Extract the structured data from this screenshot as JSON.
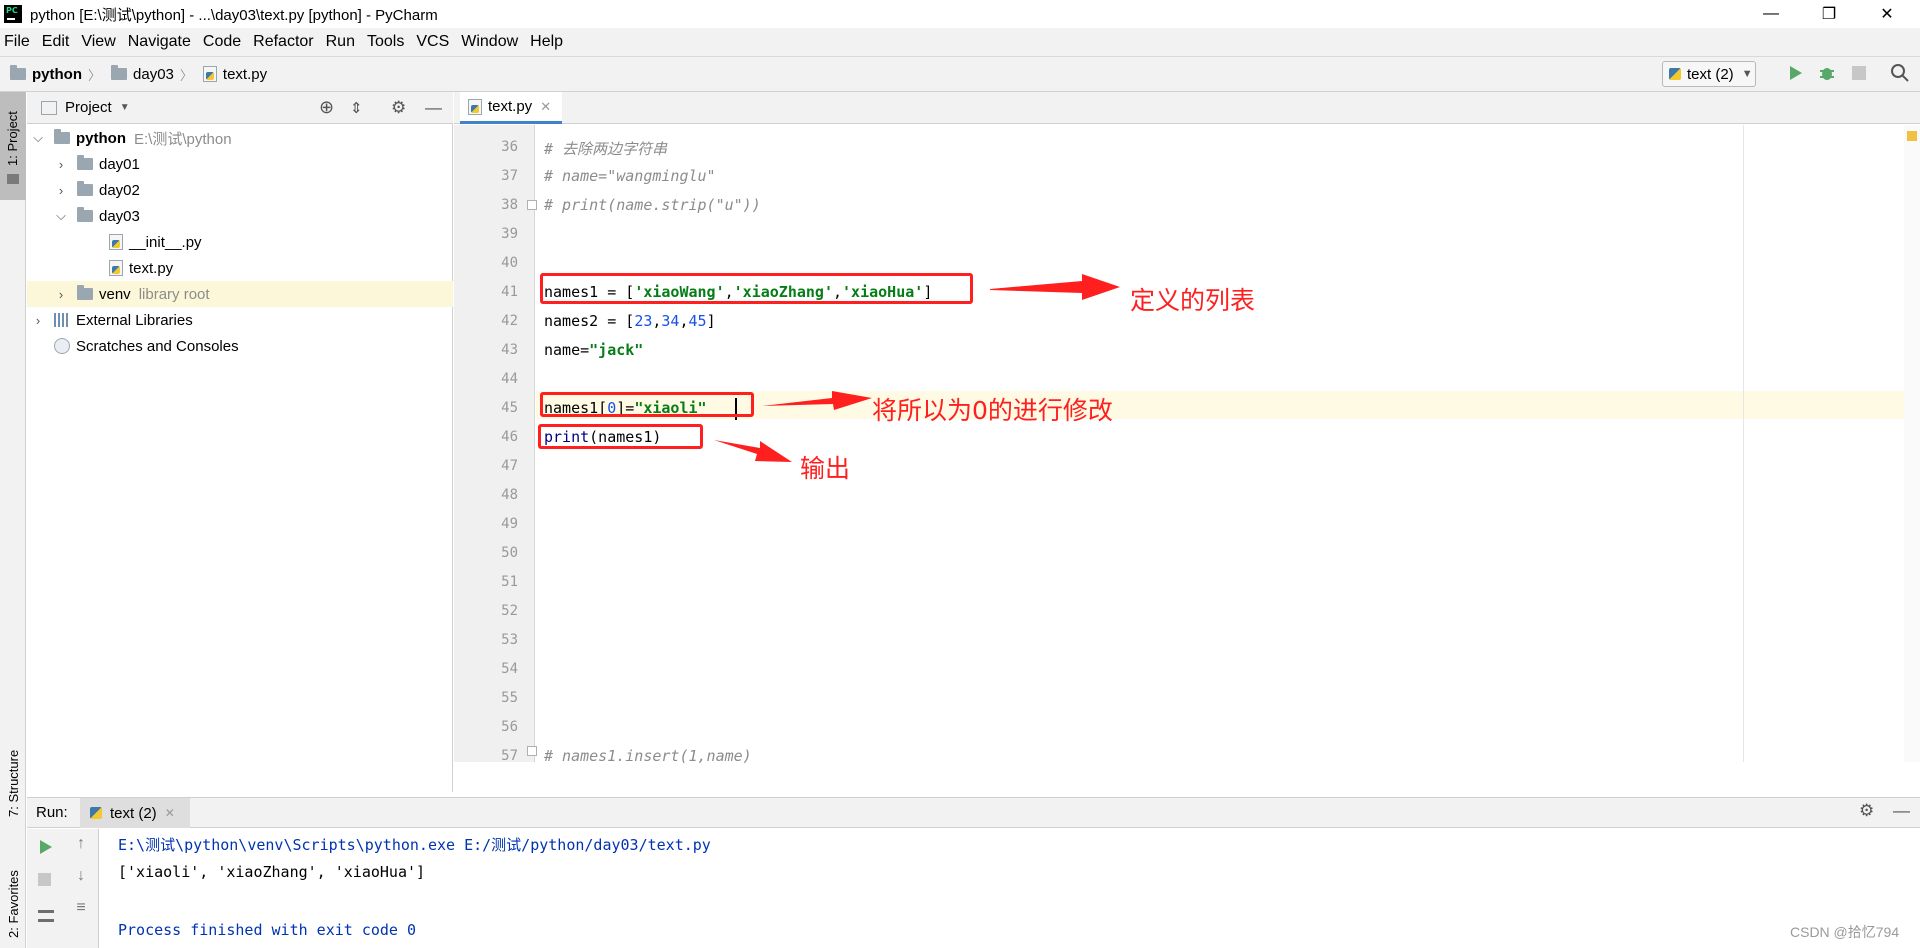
{
  "window": {
    "title": "python [E:\\测试\\python] - ...\\day03\\text.py [python] - PyCharm",
    "minimize": "—",
    "maximize": "❐",
    "close": "✕"
  },
  "menu": [
    "File",
    "Edit",
    "View",
    "Navigate",
    "Code",
    "Refactor",
    "Run",
    "Tools",
    "VCS",
    "Window",
    "Help"
  ],
  "breadcrumb": [
    "python",
    "day03",
    "text.py"
  ],
  "run_config": "text (2)",
  "stripe": {
    "project": "1: Project",
    "structure": "7: Structure",
    "favorites": "2: Favorites"
  },
  "project_panel": {
    "title": "Project",
    "tree": [
      {
        "label": "python",
        "extra": "E:\\测试\\python"
      },
      {
        "label": "day01"
      },
      {
        "label": "day02"
      },
      {
        "label": "day03"
      },
      {
        "label": "__init__.py"
      },
      {
        "label": "text.py"
      },
      {
        "label": "venv",
        "extra": "library root"
      },
      {
        "label": "External Libraries"
      },
      {
        "label": "Scratches and Consoles"
      }
    ]
  },
  "editor": {
    "tab": "text.py",
    "line_numbers": [
      "36",
      "37",
      "38",
      "39",
      "40",
      "41",
      "42",
      "43",
      "44",
      "45",
      "46",
      "47",
      "48",
      "49",
      "50",
      "51",
      "52",
      "53",
      "54",
      "55",
      "56",
      "57"
    ],
    "code": {
      "l36": "# 去除两边字符串",
      "l37": "# name=\"wangminglu\"",
      "l38": "# print(name.strip(\"u\"))",
      "l41_var": "names1 = [",
      "l41_s1": "'xiaoWang'",
      "l41_c1": ",",
      "l41_s2": "'xiaoZhang'",
      "l41_c2": ",",
      "l41_s3": "'xiaoHua'",
      "l41_end": "]",
      "l42_var": "names2 = [",
      "l42_n1": "23",
      "l42_c1": ",",
      "l42_n2": "34",
      "l42_c2": ",",
      "l42_n3": "45",
      "l42_end": "]",
      "l43_var": "name=",
      "l43_str": "\"jack\"",
      "l45_var": "names1[",
      "l45_idx": "0",
      "l45_eq": "]=",
      "l45_str": "\"xiaoli\"",
      "l46_fn": "print",
      "l46_arg": "(names1)",
      "l57": "# names1.insert(1,name)"
    }
  },
  "annotations": {
    "define": "定义的列表",
    "modify": "将所以为0的进行修改",
    "output": "输出"
  },
  "run": {
    "label": "Run:",
    "tab": "text (2)",
    "console": [
      "E:\\测试\\python\\venv\\Scripts\\python.exe E:/测试/python/day03/text.py",
      "['xiaoli', 'xiaoZhang', 'xiaoHua']",
      "",
      "Process finished with exit code 0"
    ]
  },
  "watermark": "CSDN @拾忆794",
  "colors": {
    "accent": "#4083c9",
    "annotation": "#ff1f1f",
    "string": "#067d17",
    "number": "#1750eb",
    "comment": "#8c8c8c",
    "run_green": "#59a869"
  }
}
